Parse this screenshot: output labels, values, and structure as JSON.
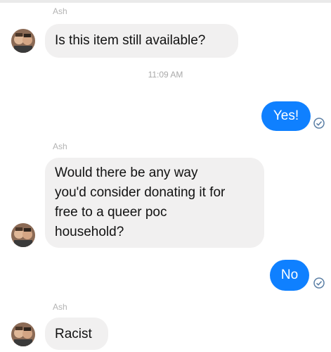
{
  "conversation": {
    "messages": [
      {
        "sender": "Ash",
        "text": "Is this item still available?"
      },
      {
        "timestamp": "11:09 AM"
      },
      {
        "outgoing": "Yes!"
      },
      {
        "sender": "Ash",
        "text": "Would there be any way\nyou'd consider donating it for\nfree to a queer poc\nhousehold?"
      },
      {
        "outgoing": "No"
      },
      {
        "sender": "Ash",
        "text": "Racist"
      }
    ]
  },
  "icons": {
    "avatar": "contact-avatar-icon",
    "seen": "seen-check-icon"
  },
  "colors": {
    "outgoing_bubble": "#0f80ff",
    "incoming_bubble": "#f1f0f0",
    "seen_check": "#5b7fa5"
  }
}
